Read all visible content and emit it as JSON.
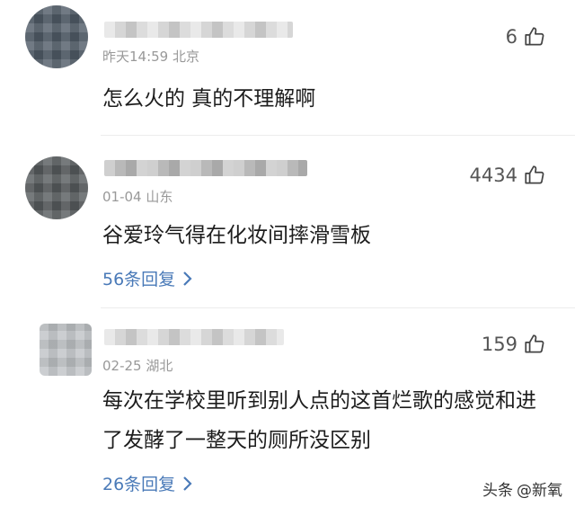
{
  "comments": [
    {
      "time": "昨天14:59",
      "location": "北京",
      "likes": "6",
      "text": "怎么火的  真的不理解啊"
    },
    {
      "time": "01-04",
      "location": "山东",
      "likes": "4434",
      "text": "谷爱玲气得在化妆间摔滑雪板",
      "replies": "56条回复"
    },
    {
      "time": "02-25",
      "location": "湖北",
      "likes": "159",
      "text": "每次在学校里听到别人点的这首烂歌的感觉和进了发酵了一整天的厕所没区别",
      "replies": "26条回复"
    }
  ],
  "watermark": {
    "source": "头条",
    "account": "@新氧"
  },
  "icons": {
    "like": "thumbs-up-icon",
    "reply_arrow": "chevron-right-icon"
  },
  "colors": {
    "link": "#4a7ab8",
    "meta": "#999999"
  }
}
